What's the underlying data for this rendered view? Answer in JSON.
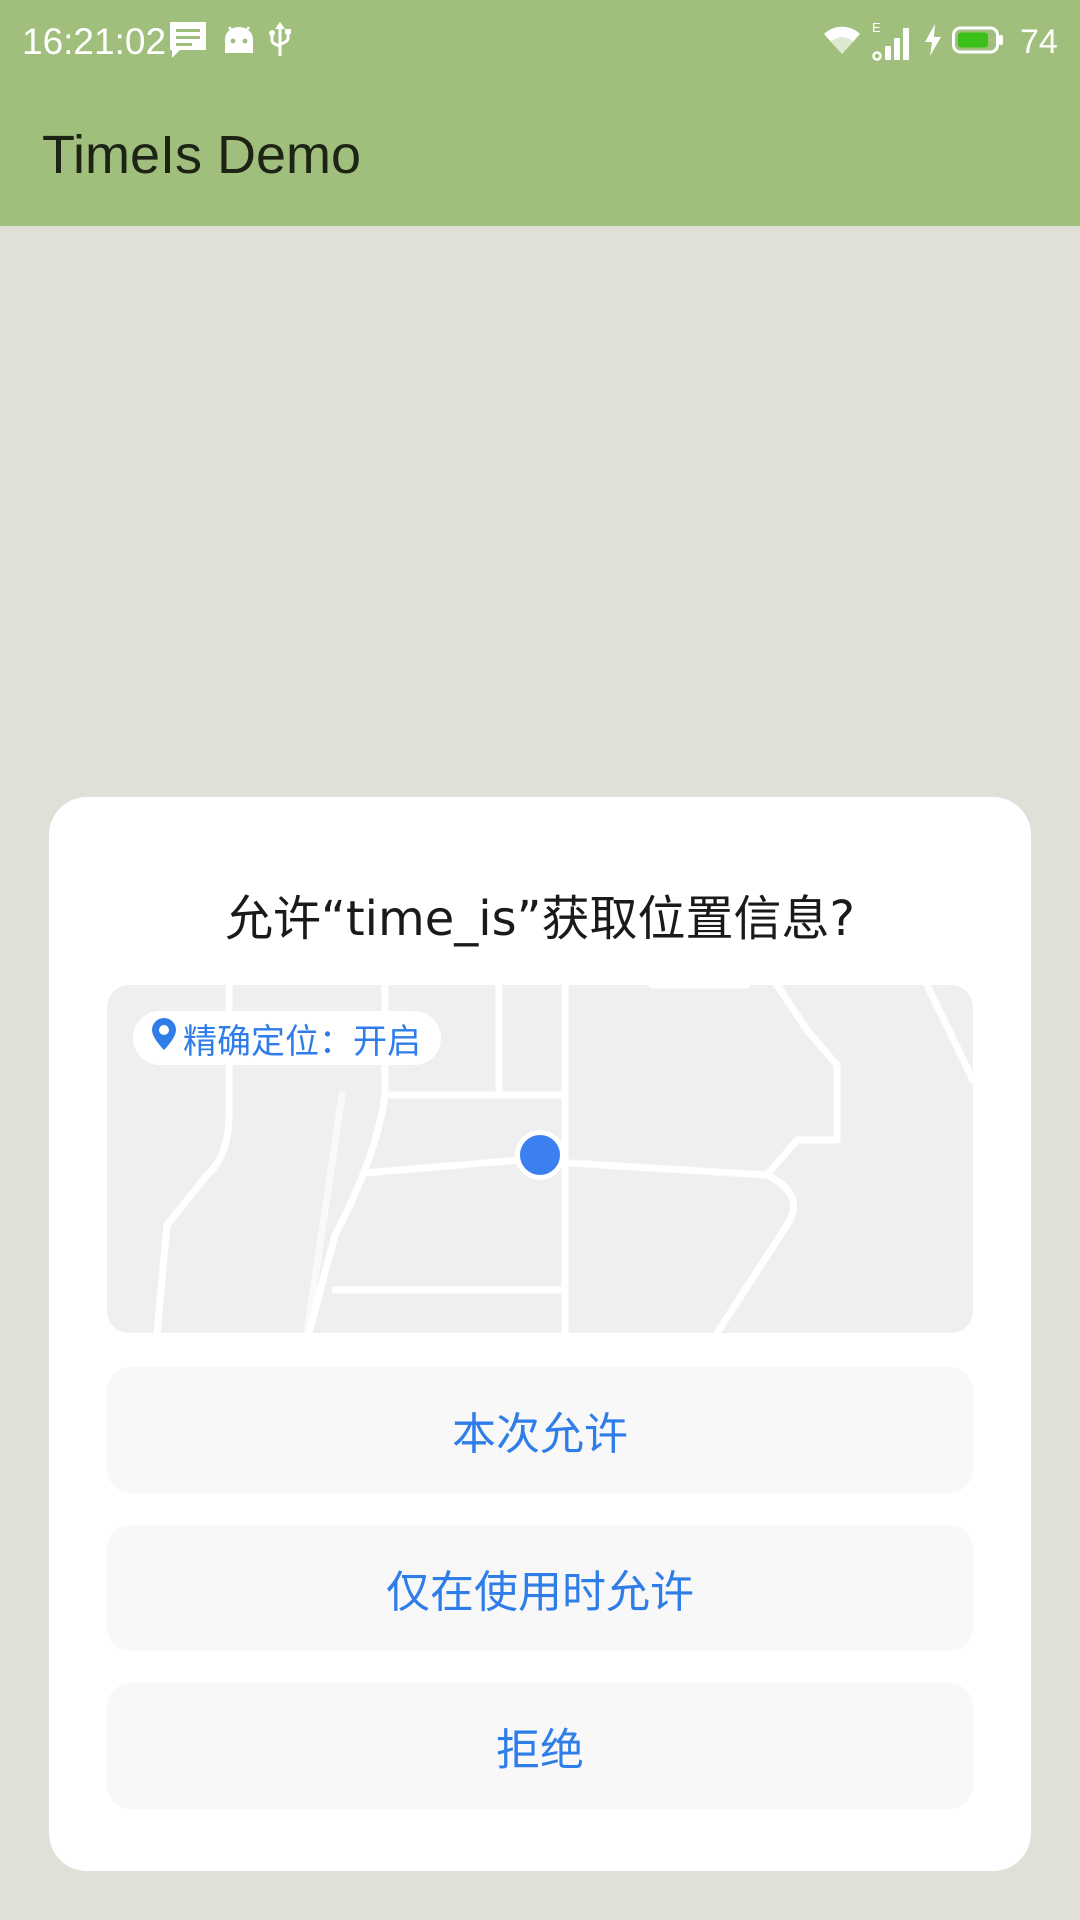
{
  "status_bar": {
    "time": "16:21:02",
    "left_icons": [
      "message-icon",
      "android-icon",
      "usb-icon"
    ],
    "right_icons": [
      "wifi-icon",
      "signal-icon",
      "charging-icon",
      "battery-icon"
    ],
    "network_type": "E",
    "battery_level": "74",
    "battery_color": "#3bc11a"
  },
  "app_bar": {
    "title": "TimeIs Demo",
    "color": "#a1bf7c"
  },
  "permission_dialog": {
    "title": "允许“time_is”获取位置信息?",
    "map": {
      "precise_location_label": "精确定位：开启",
      "pin_icon": "location-pin-icon"
    },
    "buttons": {
      "allow_once": "本次允许",
      "allow_while_using": "仅在使用时允许",
      "deny": "拒绝"
    },
    "accent_color": "#2f7de8"
  }
}
